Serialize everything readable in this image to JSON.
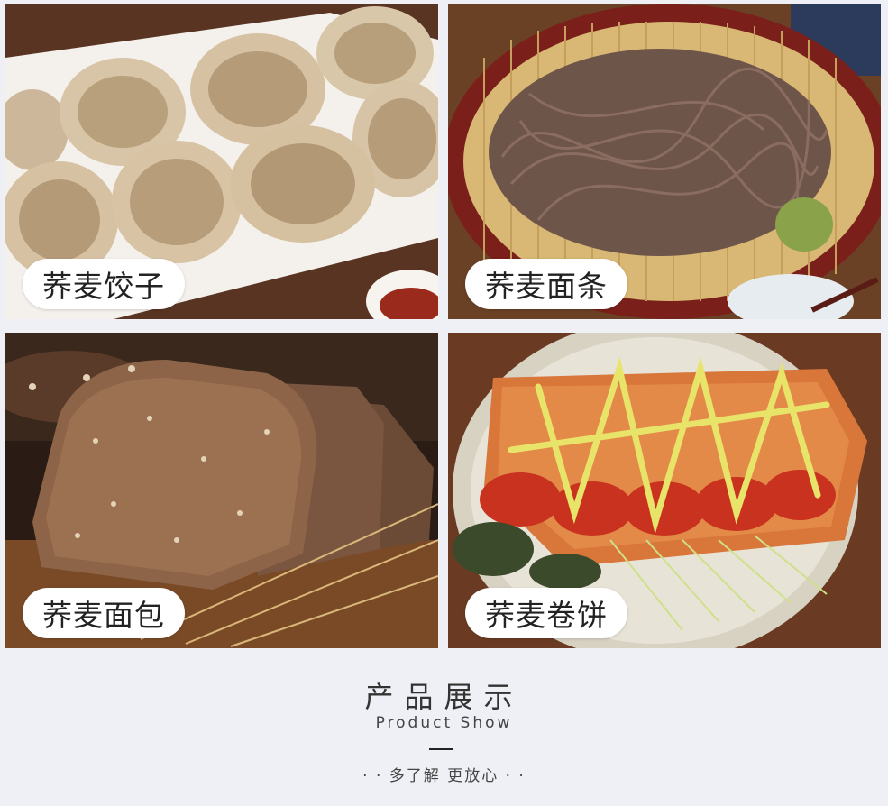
{
  "tiles": [
    {
      "label": "荞麦饺子"
    },
    {
      "label": "荞麦面条"
    },
    {
      "label": "荞麦面包"
    },
    {
      "label": "荞麦卷饼"
    }
  ],
  "footer": {
    "title_cn": "产品展示",
    "title_en": "Product Show",
    "slogan": "· · 多了解 更放心 · ·"
  }
}
